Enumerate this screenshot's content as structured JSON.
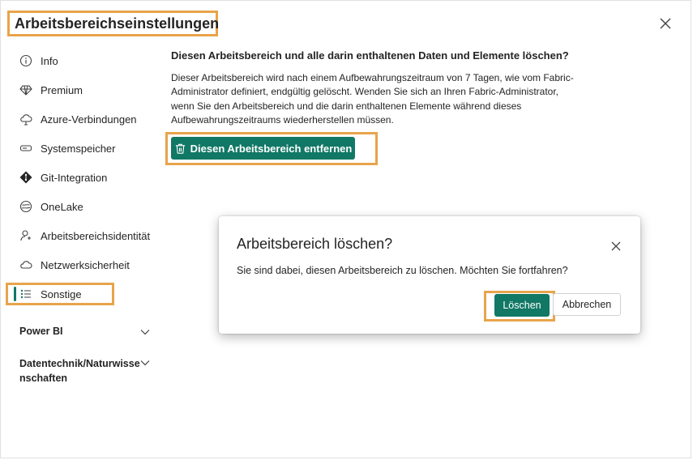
{
  "header": {
    "title": "Arbeitsbereichseinstellungen"
  },
  "sidebar": {
    "items": [
      {
        "label": "Info",
        "icon": "info-icon"
      },
      {
        "label": "Premium",
        "icon": "diamond-icon"
      },
      {
        "label": "Azure-Verbindungen",
        "icon": "cloud-icon"
      },
      {
        "label": "Systemspeicher",
        "icon": "storage-icon"
      },
      {
        "label": "Git-Integration",
        "icon": "git-icon"
      },
      {
        "label": "OneLake",
        "icon": "onelake-icon"
      },
      {
        "label": "Arbeitsbereichsidentität",
        "icon": "identity-icon"
      },
      {
        "label": "Netzwerksicherheit",
        "icon": "network-cloud-icon"
      },
      {
        "label": "Sonstige",
        "icon": "list-icon",
        "active": true
      }
    ],
    "sections": [
      {
        "label": "Power BI"
      },
      {
        "label_line1": "Datentechnik/Naturwisse",
        "label_line2": "nschaften"
      }
    ]
  },
  "main": {
    "heading": "Diesen Arbeitsbereich und alle darin enthaltenen Daten und Elemente löschen?",
    "description_lines": [
      "Dieser Arbeitsbereich wird nach einem Aufbewahrungszeitraum von 7 Tagen, wie vom Fabric-",
      "Administrator definiert, endgültig gelöscht. Wenden Sie sich an Ihren Fabric-Administrator,",
      "wenn Sie den Arbeitsbereich und die darin enthaltenen Elemente während dieses",
      "Aufbewahrungszeitraums wiederherstellen müssen."
    ],
    "remove_button": "Diesen Arbeitsbereich entfernen"
  },
  "dialog": {
    "title": "Arbeitsbereich löschen?",
    "message": "Sie sind dabei, diesen Arbeitsbereich zu löschen. Möchten Sie fortfahren?",
    "confirm_label": "Löschen",
    "cancel_label": "Abbrechen"
  },
  "colors": {
    "accent": "#117865",
    "highlight": "#e8a44b"
  }
}
